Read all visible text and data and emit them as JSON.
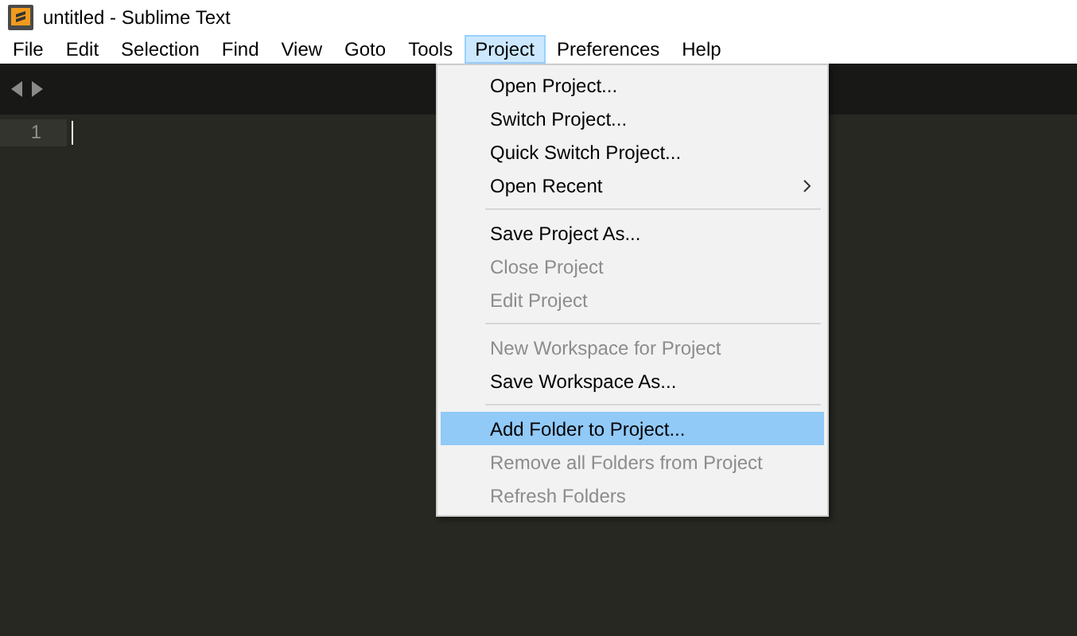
{
  "window": {
    "title": "untitled - Sublime Text"
  },
  "menu_bar": [
    {
      "label": "File",
      "selected": false
    },
    {
      "label": "Edit",
      "selected": false
    },
    {
      "label": "Selection",
      "selected": false
    },
    {
      "label": "Find",
      "selected": false
    },
    {
      "label": "View",
      "selected": false
    },
    {
      "label": "Goto",
      "selected": false
    },
    {
      "label": "Tools",
      "selected": false
    },
    {
      "label": "Project",
      "selected": true
    },
    {
      "label": "Preferences",
      "selected": false
    },
    {
      "label": "Help",
      "selected": false
    }
  ],
  "editor": {
    "line_numbers": [
      "1"
    ]
  },
  "project_menu": [
    {
      "kind": "item",
      "label": "Open Project...",
      "disabled": false,
      "selected": false,
      "submenu": false
    },
    {
      "kind": "item",
      "label": "Switch Project...",
      "disabled": false,
      "selected": false,
      "submenu": false
    },
    {
      "kind": "item",
      "label": "Quick Switch Project...",
      "disabled": false,
      "selected": false,
      "submenu": false
    },
    {
      "kind": "item",
      "label": "Open Recent",
      "disabled": false,
      "selected": false,
      "submenu": true
    },
    {
      "kind": "separator"
    },
    {
      "kind": "item",
      "label": "Save Project As...",
      "disabled": false,
      "selected": false,
      "submenu": false
    },
    {
      "kind": "item",
      "label": "Close Project",
      "disabled": true,
      "selected": false,
      "submenu": false
    },
    {
      "kind": "item",
      "label": "Edit Project",
      "disabled": true,
      "selected": false,
      "submenu": false
    },
    {
      "kind": "separator"
    },
    {
      "kind": "item",
      "label": "New Workspace for Project",
      "disabled": true,
      "selected": false,
      "submenu": false
    },
    {
      "kind": "item",
      "label": "Save Workspace As...",
      "disabled": false,
      "selected": false,
      "submenu": false
    },
    {
      "kind": "separator"
    },
    {
      "kind": "item",
      "label": "Add Folder to Project...",
      "disabled": false,
      "selected": true,
      "submenu": false
    },
    {
      "kind": "item",
      "label": "Remove all Folders from Project",
      "disabled": true,
      "selected": false,
      "submenu": false
    },
    {
      "kind": "item",
      "label": "Refresh Folders",
      "disabled": true,
      "selected": false,
      "submenu": false
    }
  ]
}
